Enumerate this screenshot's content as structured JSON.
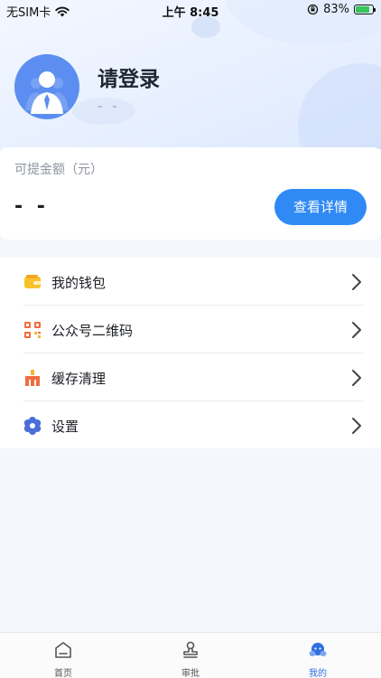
{
  "status_bar": {
    "carrier": "无SIM卡",
    "time": "上午 8:45",
    "battery": "83%"
  },
  "profile": {
    "title": "请登录",
    "subtitle": "- -"
  },
  "balance": {
    "label": "可提金额（元）",
    "value": "- -",
    "button": "查看详情"
  },
  "menu": {
    "items": [
      {
        "label": "我的钱包",
        "icon": "wallet-icon"
      },
      {
        "label": "公众号二维码",
        "icon": "qrcode-icon"
      },
      {
        "label": "缓存清理",
        "icon": "broom-icon"
      },
      {
        "label": "设置",
        "icon": "gear-icon"
      }
    ]
  },
  "tabs": [
    {
      "label": "首页",
      "icon": "home-icon"
    },
    {
      "label": "审批",
      "icon": "stamp-icon"
    },
    {
      "label": "我的",
      "icon": "profile-icon",
      "active": true
    }
  ],
  "colors": {
    "accent": "#2f8af5",
    "avatar": "#5b8ef0",
    "tab_active": "#2f6fe0"
  }
}
